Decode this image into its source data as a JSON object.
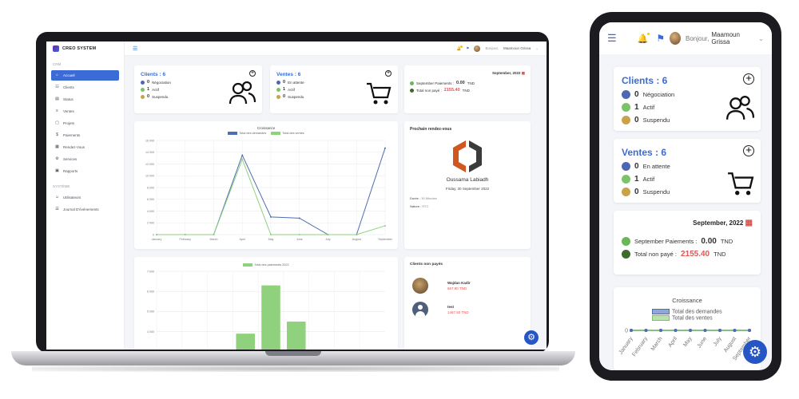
{
  "brand": {
    "name": "CREO SYSTEM"
  },
  "sidebar": {
    "section_crm": "CRM",
    "section_system": "SYSTÈME",
    "items": [
      {
        "label": "Accueil",
        "icon": "home-icon",
        "active": true
      },
      {
        "label": "Clients",
        "icon": "users-icon"
      },
      {
        "label": "Status",
        "icon": "status-icon"
      },
      {
        "label": "Ventes",
        "icon": "sales-icon"
      },
      {
        "label": "Projets",
        "icon": "folder-icon"
      },
      {
        "label": "Paiements",
        "icon": "dollar-icon"
      },
      {
        "label": "Rendez-Vous",
        "icon": "calendar-icon"
      },
      {
        "label": "Services",
        "icon": "services-icon"
      },
      {
        "label": "Rapports",
        "icon": "report-icon"
      }
    ],
    "system_items": [
      {
        "label": "Utilisateurs",
        "icon": "user-icon"
      },
      {
        "label": "Journal D'évènements",
        "icon": "log-icon"
      }
    ]
  },
  "header": {
    "greeting": "Bonjour,",
    "user": "Maamoun Grissa"
  },
  "clients_card": {
    "title": "Clients : 6",
    "stats": [
      {
        "count": "0",
        "label": "Négociation",
        "color": "#4f66b0"
      },
      {
        "count": "1",
        "label": "Actif",
        "color": "#7cc26a"
      },
      {
        "count": "0",
        "label": "Suspendu",
        "color": "#c9a24a"
      }
    ]
  },
  "ventes_card": {
    "title": "Ventes : 6",
    "stats": [
      {
        "count": "0",
        "label": "En attente",
        "color": "#4f66b0"
      },
      {
        "count": "1",
        "label": "Actif",
        "color": "#7cc26a"
      },
      {
        "count": "0",
        "label": "Suspendu",
        "color": "#c9a24a"
      }
    ]
  },
  "payments_card": {
    "month": "September, 2022",
    "paid_label": "September Paiements :",
    "paid_value": "0.00",
    "paid_currency": "TND",
    "unpaid_label": "Total non payé :",
    "unpaid_value": "2155.40",
    "unpaid_currency": "TND"
  },
  "rdv_card": {
    "title": "Prochain rendez-vous",
    "person": "Oussama Labiadh",
    "date": "Friday, 30 September 2022",
    "duration_label": "Durée :",
    "duration_value": "30 Minutes",
    "kind_label": "Nature :",
    "kind_value": "RTC"
  },
  "unpaid_clients": {
    "title": "Clients non payés",
    "items": [
      {
        "name": "Wajdan Kadir",
        "amount": "667.90 TND"
      },
      {
        "name": "test",
        "amount": "1487.50 TND"
      }
    ]
  },
  "chart_data": [
    {
      "type": "line",
      "title": "Croissance",
      "categories": [
        "January",
        "February",
        "March",
        "April",
        "May",
        "June",
        "July",
        "August",
        "September"
      ],
      "series": [
        {
          "name": "Total des demandes",
          "color": "#4f6db0",
          "values": [
            0,
            0,
            0,
            13.5,
            3,
            2.8,
            0,
            0,
            14.7
          ]
        },
        {
          "name": "Total des ventes",
          "color": "#8fd17c",
          "values": [
            0,
            0,
            0,
            12.8,
            0,
            0,
            0,
            0,
            1.5
          ]
        }
      ],
      "ylim": [
        0,
        16
      ],
      "yticks": [
        "0",
        "2 000",
        "4 000",
        "6 000",
        "8 000",
        "10 000",
        "12 000",
        "14 000",
        "16 000"
      ],
      "grid": true,
      "legend": "top"
    },
    {
      "type": "bar",
      "title": "Total des paiements 2022",
      "series": [
        {
          "name": "Total des paiements 2022",
          "color": "#8fd17c",
          "values": [
            0,
            0,
            0,
            3.9,
            6.3,
            4.5,
            0,
            0,
            0
          ]
        }
      ],
      "ylim": [
        2,
        7
      ],
      "yticks": [
        "2 000",
        "3 000",
        "4 000",
        "5 000",
        "6 000",
        "7 000"
      ],
      "grid": true,
      "legend": "top"
    },
    {
      "type": "line",
      "title": "Croissance",
      "categories": [
        "January",
        "February",
        "March",
        "April",
        "May",
        "June",
        "July",
        "August",
        "September"
      ],
      "series": [
        {
          "name": "Total des demandes",
          "color": "#4f6db0",
          "values": [
            0,
            0,
            0,
            0,
            0,
            0,
            0,
            0,
            0
          ]
        },
        {
          "name": "Total des ventes",
          "color": "#8fd17c",
          "values": [
            0,
            0,
            0,
            0,
            0,
            0,
            0,
            0,
            0
          ]
        }
      ],
      "yticks": [
        "0"
      ],
      "legend": "top"
    }
  ]
}
